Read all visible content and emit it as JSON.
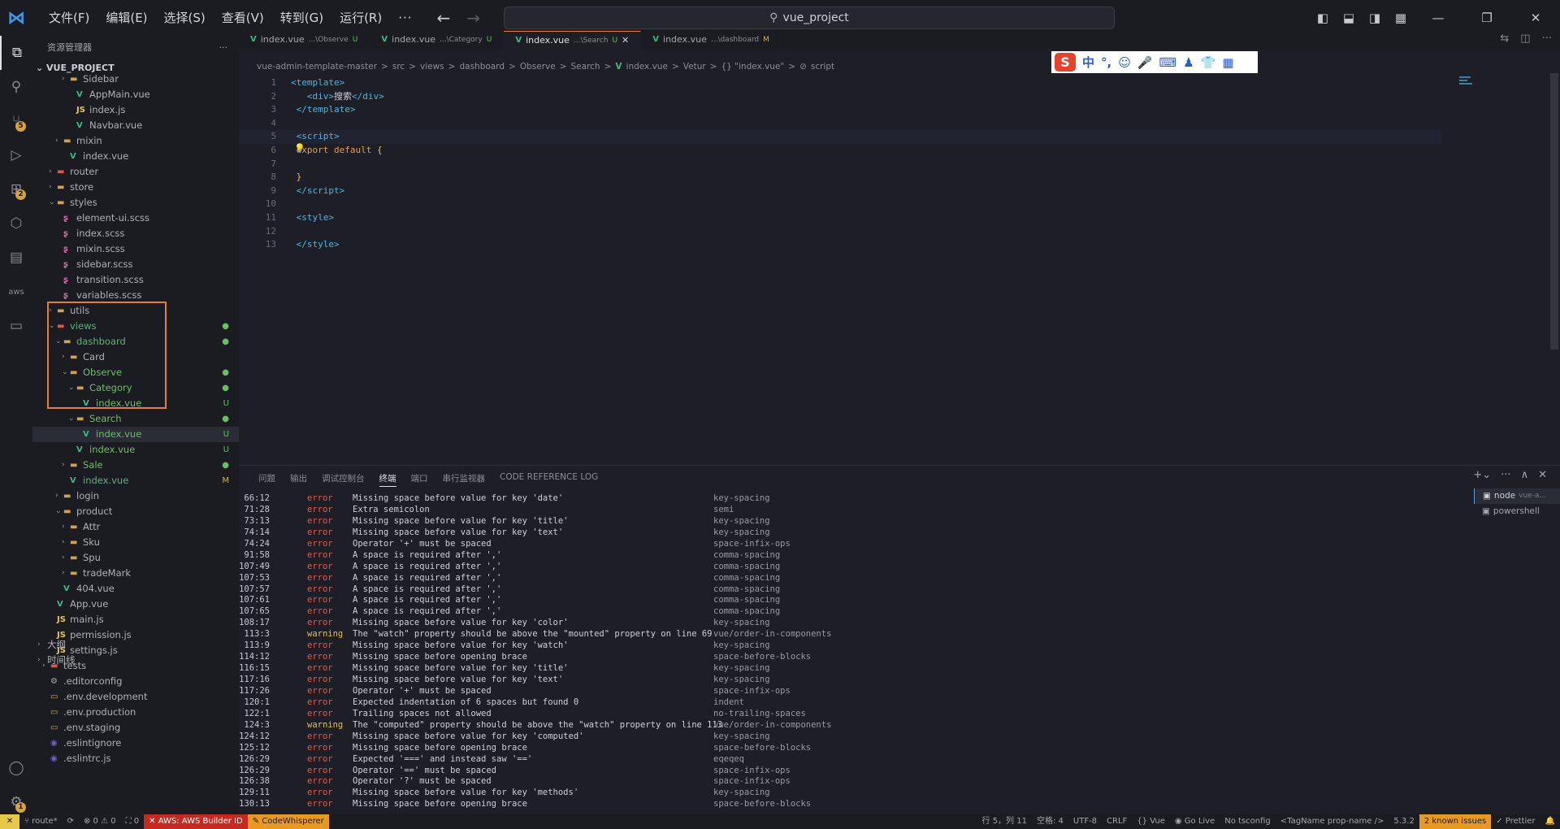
{
  "titlebar": {
    "menus": [
      "文件(F)",
      "编辑(E)",
      "选择(S)",
      "查看(V)",
      "转到(G)",
      "运行(R)",
      "···"
    ],
    "search_text": "vue_project"
  },
  "sidebar": {
    "header": "资源管理器",
    "project": "VUE_PROJECT",
    "tree": [
      {
        "indent": 3,
        "chev": "›",
        "icon": "folder",
        "name": "Sidebar",
        "color": "gray"
      },
      {
        "indent": 4,
        "chev": "",
        "icon": "vue",
        "name": "AppMain.vue",
        "color": "gray"
      },
      {
        "indent": 4,
        "chev": "",
        "icon": "js",
        "name": "index.js",
        "color": "gray"
      },
      {
        "indent": 4,
        "chev": "",
        "icon": "vue",
        "name": "Navbar.vue",
        "color": "gray"
      },
      {
        "indent": 2,
        "chev": "›",
        "icon": "folder",
        "name": "mixin",
        "color": "gray"
      },
      {
        "indent": 3,
        "chev": "",
        "icon": "vue",
        "name": "index.vue",
        "color": "gray"
      },
      {
        "indent": 1,
        "chev": "›",
        "icon": "folder-red",
        "name": "router",
        "color": "gray"
      },
      {
        "indent": 1,
        "chev": "›",
        "icon": "folder",
        "name": "store",
        "color": "gray"
      },
      {
        "indent": 1,
        "chev": "⌄",
        "icon": "folder-blue",
        "name": "styles",
        "color": "gray"
      },
      {
        "indent": 2,
        "chev": "",
        "icon": "scss",
        "name": "element-ui.scss",
        "color": "gray"
      },
      {
        "indent": 2,
        "chev": "",
        "icon": "scss",
        "name": "index.scss",
        "color": "gray"
      },
      {
        "indent": 2,
        "chev": "",
        "icon": "scss",
        "name": "mixin.scss",
        "color": "gray"
      },
      {
        "indent": 2,
        "chev": "",
        "icon": "scss",
        "name": "sidebar.scss",
        "color": "gray"
      },
      {
        "indent": 2,
        "chev": "",
        "icon": "scss",
        "name": "transition.scss",
        "color": "gray"
      },
      {
        "indent": 2,
        "chev": "",
        "icon": "scss",
        "name": "variables.scss",
        "color": "gray"
      },
      {
        "indent": 1,
        "chev": "›",
        "icon": "folder",
        "name": "utils",
        "color": "gray"
      },
      {
        "indent": 1,
        "chev": "⌄",
        "icon": "folder-red",
        "name": "views",
        "color": "blueg",
        "status": "●"
      },
      {
        "indent": 2,
        "chev": "⌄",
        "icon": "folder",
        "name": "dashboard",
        "color": "blueg",
        "status": "●"
      },
      {
        "indent": 3,
        "chev": "›",
        "icon": "folder",
        "name": "Card",
        "color": "gray"
      },
      {
        "indent": 3,
        "chev": "⌄",
        "icon": "folder",
        "name": "Observe",
        "color": "green",
        "status": "●"
      },
      {
        "indent": 4,
        "chev": "⌄",
        "icon": "folder",
        "name": "Category",
        "color": "green",
        "status": "●"
      },
      {
        "indent": 5,
        "chev": "",
        "icon": "vue",
        "name": "index.vue",
        "color": "green",
        "status": "U"
      },
      {
        "indent": 4,
        "chev": "⌄",
        "icon": "folder",
        "name": "Search",
        "color": "green",
        "status": "●"
      },
      {
        "indent": 5,
        "chev": "",
        "icon": "vue",
        "name": "index.vue",
        "color": "green",
        "status": "U",
        "selected": true
      },
      {
        "indent": 4,
        "chev": "",
        "icon": "vue",
        "name": "index.vue",
        "color": "green",
        "status": "U"
      },
      {
        "indent": 3,
        "chev": "›",
        "icon": "folder",
        "name": "Sale",
        "color": "green",
        "status": "●"
      },
      {
        "indent": 3,
        "chev": "",
        "icon": "vue",
        "name": "index.vue",
        "color": "blueg",
        "status": "M"
      },
      {
        "indent": 2,
        "chev": "›",
        "icon": "folder",
        "name": "login",
        "color": "gray"
      },
      {
        "indent": 2,
        "chev": "⌄",
        "icon": "folder",
        "name": "product",
        "color": "gray"
      },
      {
        "indent": 3,
        "chev": "›",
        "icon": "folder",
        "name": "Attr",
        "color": "gray"
      },
      {
        "indent": 3,
        "chev": "›",
        "icon": "folder",
        "name": "Sku",
        "color": "gray"
      },
      {
        "indent": 3,
        "chev": "›",
        "icon": "folder",
        "name": "Spu",
        "color": "gray"
      },
      {
        "indent": 3,
        "chev": "›",
        "icon": "folder",
        "name": "tradeMark",
        "color": "gray"
      },
      {
        "indent": 2,
        "chev": "",
        "icon": "vue",
        "name": "404.vue",
        "color": "gray"
      },
      {
        "indent": 1,
        "chev": "",
        "icon": "vue",
        "name": "App.vue",
        "color": "gray"
      },
      {
        "indent": 1,
        "chev": "",
        "icon": "js",
        "name": "main.js",
        "color": "gray"
      },
      {
        "indent": 1,
        "chev": "",
        "icon": "js",
        "name": "permission.js",
        "color": "gray"
      },
      {
        "indent": 1,
        "chev": "",
        "icon": "js",
        "name": "settings.js",
        "color": "gray"
      },
      {
        "indent": 0,
        "chev": "›",
        "icon": "folder-red",
        "name": "tests",
        "color": "gray"
      },
      {
        "indent": 0,
        "chev": "",
        "icon": "gear",
        "name": ".editorconfig",
        "color": "gray"
      },
      {
        "indent": 0,
        "chev": "",
        "icon": "env",
        "name": ".env.development",
        "color": "gray"
      },
      {
        "indent": 0,
        "chev": "",
        "icon": "env",
        "name": ".env.production",
        "color": "gray"
      },
      {
        "indent": 0,
        "chev": "",
        "icon": "env",
        "name": ".env.staging",
        "color": "gray"
      },
      {
        "indent": 0,
        "chev": "",
        "icon": "eslint",
        "name": ".eslintignore",
        "color": "gray"
      },
      {
        "indent": 0,
        "chev": "",
        "icon": "eslint",
        "name": ".eslintrc.js",
        "color": "gray"
      }
    ],
    "outline": "大纲",
    "timeline": "时间线"
  },
  "tabs": [
    {
      "name": "index.vue",
      "path": "...\\Observe",
      "badge": "U",
      "badge_type": "u",
      "active": false
    },
    {
      "name": "index.vue",
      "path": "...\\Category",
      "badge": "U",
      "badge_type": "u",
      "active": false
    },
    {
      "name": "index.vue",
      "path": "...\\Search",
      "badge": "U",
      "badge_type": "u",
      "active": true
    },
    {
      "name": "index.vue",
      "path": "...\\dashboard",
      "badge": "M",
      "badge_type": "m",
      "active": false
    }
  ],
  "breadcrumb": [
    "vue-admin-template-master",
    ">",
    "src",
    ">",
    "views",
    ">",
    "dashboard",
    ">",
    "Observe",
    ">",
    "Search",
    ">",
    "V",
    "index.vue",
    ">",
    "Vetur",
    ">",
    "{} \"index.vue\"",
    ">",
    "⊘",
    "script"
  ],
  "ime": {
    "logo": "S",
    "lang": "中",
    "punct": "°,"
  },
  "code": {
    "lines": [
      {
        "n": "1",
        "html": "<span class='tg'>&lt;template&gt;</span>"
      },
      {
        "n": "2",
        "html": "   <span class='tg'>&lt;div&gt;</span>搜索<span class='tg'>&lt;/div&gt;</span>"
      },
      {
        "n": "3",
        "html": " <span class='tg'>&lt;/template&gt;</span>"
      },
      {
        "n": "4",
        "html": ""
      },
      {
        "n": "5",
        "html": " <span class='tg'>&lt;script&gt;</span>",
        "current": true
      },
      {
        "n": "6",
        "html": " <span class='kw'>export default</span> <span class='br'>{</span>"
      },
      {
        "n": "7",
        "html": ""
      },
      {
        "n": "8",
        "html": " <span class='br'>}</span>"
      },
      {
        "n": "9",
        "html": " <span class='tg'>&lt;/script&gt;</span>"
      },
      {
        "n": "10",
        "html": ""
      },
      {
        "n": "11",
        "html": " <span class='tg'>&lt;style&gt;</span>"
      },
      {
        "n": "12",
        "html": ""
      },
      {
        "n": "13",
        "html": " <span class='tg'>&lt;/style&gt;</span>"
      }
    ]
  },
  "panel": {
    "tabs": [
      "问题",
      "输出",
      "调试控制台",
      "终端",
      "端口",
      "串行监视器",
      "CODE REFERENCE LOG"
    ],
    "active_tab": "终端",
    "terminals": [
      {
        "name": "node",
        "sub": "vue-a...",
        "active": true
      },
      {
        "name": "powershell",
        "sub": "",
        "active": false
      }
    ],
    "lines": [
      [
        "66:12",
        "error",
        "Missing space before value for key 'date'",
        "key-spacing"
      ],
      [
        "71:28",
        "error",
        "Extra semicolon",
        "semi"
      ],
      [
        "73:13",
        "error",
        "Missing space before value for key 'title'",
        "key-spacing"
      ],
      [
        "74:14",
        "error",
        "Missing space before value for key 'text'",
        "key-spacing"
      ],
      [
        "74:24",
        "error",
        "Operator '+' must be spaced",
        "space-infix-ops"
      ],
      [
        "91:58",
        "error",
        "A space is required after ','",
        "comma-spacing"
      ],
      [
        "107:49",
        "error",
        "A space is required after ','",
        "comma-spacing"
      ],
      [
        "107:53",
        "error",
        "A space is required after ','",
        "comma-spacing"
      ],
      [
        "107:57",
        "error",
        "A space is required after ','",
        "comma-spacing"
      ],
      [
        "107:61",
        "error",
        "A space is required after ','",
        "comma-spacing"
      ],
      [
        "107:65",
        "error",
        "A space is required after ','",
        "comma-spacing"
      ],
      [
        "108:17",
        "error",
        "Missing space before value for key 'color'",
        "key-spacing"
      ],
      [
        "113:3",
        "warning",
        "The \"watch\" property should be above the \"mounted\" property on line 69",
        "vue/order-in-components"
      ],
      [
        "113:9",
        "error",
        "Missing space before value for key 'watch'",
        "key-spacing"
      ],
      [
        "114:12",
        "error",
        "Missing space before opening brace",
        "space-before-blocks"
      ],
      [
        "116:15",
        "error",
        "Missing space before value for key 'title'",
        "key-spacing"
      ],
      [
        "117:16",
        "error",
        "Missing space before value for key 'text'",
        "key-spacing"
      ],
      [
        "117:26",
        "error",
        "Operator '+' must be spaced",
        "space-infix-ops"
      ],
      [
        "120:1",
        "error",
        "Expected indentation of 6 spaces but found 0",
        "indent"
      ],
      [
        "122:1",
        "error",
        "Trailing spaces not allowed",
        "no-trailing-spaces"
      ],
      [
        "124:3",
        "warning",
        "The \"computed\" property should be above the \"watch\" property on line 113",
        "vue/order-in-components"
      ],
      [
        "124:12",
        "error",
        "Missing space before value for key 'computed'",
        "key-spacing"
      ],
      [
        "125:12",
        "error",
        "Missing space before opening brace",
        "space-before-blocks"
      ],
      [
        "126:29",
        "error",
        "Expected '===' and instead saw '=='",
        "eqeqeq"
      ],
      [
        "126:29",
        "error",
        "Operator '==' must be spaced",
        "space-infix-ops"
      ],
      [
        "126:38",
        "error",
        "Operator '?' must be spaced",
        "space-infix-ops"
      ],
      [
        "129:11",
        "error",
        "Missing space before value for key 'methods'",
        "key-spacing"
      ],
      [
        "130:13",
        "error",
        "Missing space before opening brace",
        "space-before-blocks"
      ]
    ]
  },
  "status": {
    "remote": "✕",
    "branch": "route*",
    "sync": "⟳",
    "problems": "⊗ 0 ⚠ 0",
    "ports": "⛶ 0",
    "aws": "✕ AWS: AWS Builder ID",
    "codewhisperer": "CodeWhisperer",
    "position": "行 5，列 11",
    "spaces": "空格: 4",
    "encoding": "UTF-8",
    "eol": "CRLF",
    "lang": "{} Vue",
    "golive": "Go Live",
    "tsconfig": "No tsconfig",
    "tagname": "<TagName prop-name />",
    "version": "5.3.2",
    "issues": "2 known issues",
    "prettier": "✓ Prettier",
    "bell": "🔔"
  },
  "activity_badges": {
    "scm": "5",
    "extensions": "2",
    "settings": "1"
  },
  "colors": {
    "accent_orange": "#e8802a",
    "vue_green": "#41b883",
    "error_red": "#e25a4c",
    "warning_yellow": "#e0c050"
  }
}
